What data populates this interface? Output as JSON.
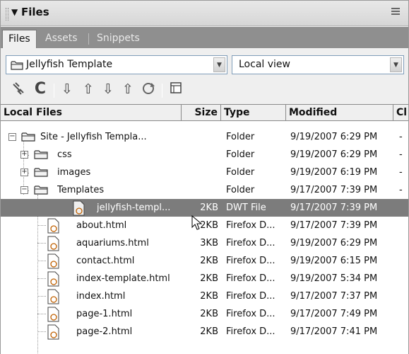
{
  "panel": {
    "title": "Files",
    "tabs": [
      "Files",
      "Assets",
      "Snippets"
    ],
    "site_select": "Jellyfish Template",
    "view_select": "Local view"
  },
  "columns": {
    "name": "Local Files",
    "size": "Size",
    "type": "Type",
    "modified": "Modified",
    "checked_out": "Cl"
  },
  "rows": [
    {
      "name": "Site - Jellyfish Templa...",
      "size": "",
      "type": "Folder",
      "modified": "9/19/2007 6:29 PM",
      "co": "-"
    },
    {
      "name": "css",
      "size": "",
      "type": "Folder",
      "modified": "9/19/2007 6:29 PM",
      "co": "-"
    },
    {
      "name": "images",
      "size": "",
      "type": "Folder",
      "modified": "9/19/2007 6:19 PM",
      "co": "-"
    },
    {
      "name": "Templates",
      "size": "",
      "type": "Folder",
      "modified": "9/17/2007 7:39 PM",
      "co": "-"
    },
    {
      "name": "jellyfish-templ...",
      "size": "2KB",
      "type": "DWT File",
      "modified": "9/17/2007 7:39 PM",
      "co": ""
    },
    {
      "name": "about.html",
      "size": "2KB",
      "type": "Firefox D...",
      "modified": "9/17/2007 7:39 PM",
      "co": ""
    },
    {
      "name": "aquariums.html",
      "size": "3KB",
      "type": "Firefox D...",
      "modified": "9/19/2007 6:29 PM",
      "co": ""
    },
    {
      "name": "contact.html",
      "size": "2KB",
      "type": "Firefox D...",
      "modified": "9/19/2007 6:15 PM",
      "co": ""
    },
    {
      "name": "index-template.html",
      "size": "2KB",
      "type": "Firefox D...",
      "modified": "9/19/2007 5:34 PM",
      "co": ""
    },
    {
      "name": "index.html",
      "size": "2KB",
      "type": "Firefox D...",
      "modified": "9/17/2007 7:37 PM",
      "co": ""
    },
    {
      "name": "page-1.html",
      "size": "2KB",
      "type": "Firefox D...",
      "modified": "9/17/2007 7:49 PM",
      "co": ""
    },
    {
      "name": "page-2.html",
      "size": "2KB",
      "type": "Firefox D...",
      "modified": "9/17/2007 7:41 PM",
      "co": ""
    }
  ],
  "colors": {
    "selected_row": "#7c7c7c",
    "tab_strip": "#8f8f8f"
  }
}
